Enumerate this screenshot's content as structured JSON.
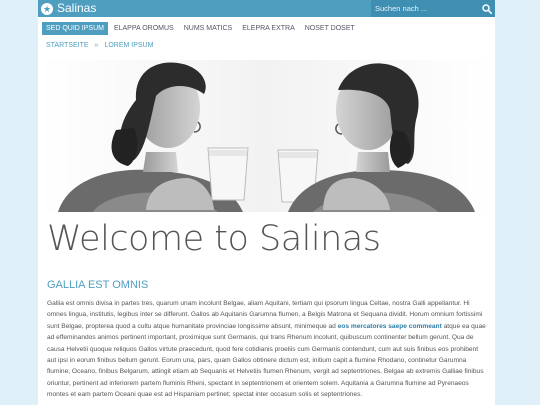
{
  "site": {
    "title": "Salinas"
  },
  "search": {
    "placeholder": "Suchen nach ..."
  },
  "nav": {
    "items": [
      {
        "label": "SED QUID IPSUM",
        "active": true
      },
      {
        "label": "ELAPPA OROMUS",
        "active": false
      },
      {
        "label": "NUMS MATICS",
        "active": false
      },
      {
        "label": "ELEPRA EXTRA",
        "active": false
      },
      {
        "label": "NOSET DOSET",
        "active": false
      }
    ]
  },
  "breadcrumb": {
    "home": "STARTSEITE",
    "separator": "»",
    "current": "LOREM IPSUM"
  },
  "main": {
    "heading": "Welcome to Salinas",
    "section_title": "GALLIA EST OMNIS",
    "paragraph_before_link": "Gallia est omnis divisa in partes tres, quarum unam incolunt Belgae, aliam Aquitani, tertiam qui ipsorum lingua Celtae, nostra Galli appellantur. Hi omnes lingua, institutis, legibus inter se differunt. Gallos ab Aquitanis Garumna flumen, a Belgis Matrona et Sequana dividit. Horum omnium fortissimi sunt Belgae, propterea quod a cultu atque humanitate provinciae longissime absunt, minimeque ad ",
    "paragraph_link": "eos mercatores saepe commeant",
    "paragraph_after_link": " atque ea quae ad effeminandos animos pertinent important, proximique sunt Germanis, qui trans Rhenum incolunt, quibuscum continenter bellum gerunt. Qua de causa Helvetii quoque reliquos Gallos virtute praecedunt, quod fere cotidianis proeliis cum Germanis contendunt, cum aut suis finibus eos prohibent aut ipsi in eorum finibus bellum gerunt. Eorum una, pars, quam Gallos obtinere dictum est, initium capit a flumine Rhodano, continetur Garumna flumine, Oceano, finibus Belgarum, attingit etiam ab Sequanis et Helvetiis flumen Rhenum, vergit ad septentriones. Belgae ab extremis Galliae finibus oriuntur, pertinent ad inferiorem partem fluminis Rheni, spectant in septentrionem et orientem solem. Aquitania a Garumna flumine ad Pyrenaeos montes et eam partem Oceani quae est ad Hispaniam pertinet; spectat inter occasum solis et septentriones."
  },
  "colors": {
    "accent": "#4e9ec0",
    "background": "#dff0f8",
    "text": "#555555"
  },
  "icons": {
    "logo": "star-circle-icon",
    "search": "search-icon"
  }
}
